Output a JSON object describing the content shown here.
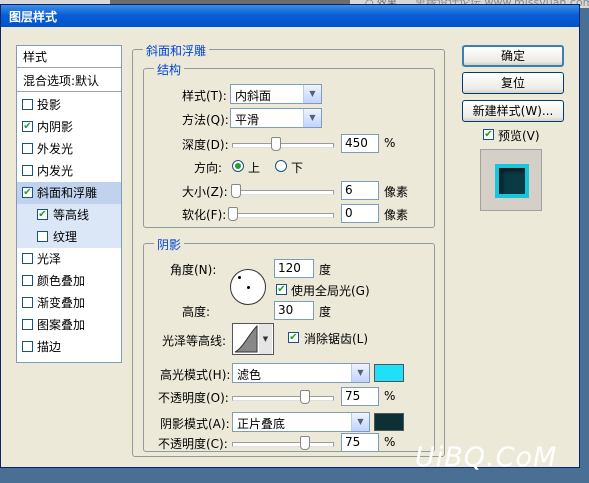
{
  "top_strip": {
    "left_text": "○ 效果",
    "watermark": "思缘设计论坛 www.missvuan.com"
  },
  "window": {
    "title": "图层样式"
  },
  "styles_panel": {
    "header": "样式",
    "blending": "混合选项:默认",
    "items": [
      {
        "label": "投影",
        "checked": false
      },
      {
        "label": "内阴影",
        "checked": true
      },
      {
        "label": "外发光",
        "checked": false
      },
      {
        "label": "内发光",
        "checked": false
      },
      {
        "label": "斜面和浮雕",
        "checked": true
      },
      {
        "label": "等高线",
        "checked": true
      },
      {
        "label": "纹理",
        "checked": false
      },
      {
        "label": "光泽",
        "checked": false
      },
      {
        "label": "颜色叠加",
        "checked": false
      },
      {
        "label": "渐变叠加",
        "checked": false
      },
      {
        "label": "图案叠加",
        "checked": false
      },
      {
        "label": "描边",
        "checked": false
      }
    ]
  },
  "bevel": {
    "group_title": "斜面和浮雕",
    "structure": {
      "title": "结构",
      "style_label": "样式(T):",
      "style_value": "内斜面",
      "technique_label": "方法(Q):",
      "technique_value": "平滑",
      "depth_label": "深度(D):",
      "depth_value": "450",
      "depth_unit": "%",
      "depth_slider": 0.45,
      "direction_label": "方向:",
      "direction_up": "上",
      "direction_down": "下",
      "direction_selected": "上",
      "size_label": "大小(Z):",
      "size_value": "6",
      "size_unit": "像素",
      "size_slider": 0.03,
      "soften_label": "软化(F):",
      "soften_value": "0",
      "soften_unit": "像素",
      "soften_slider": 0
    },
    "shading": {
      "title": "阴影",
      "angle_label": "角度(N):",
      "angle_value": "120",
      "angle_unit": "度",
      "global_light_label": "使用全局光(G)",
      "global_light": true,
      "altitude_label": "高度:",
      "altitude_value": "30",
      "altitude_unit": "度",
      "gloss_contour_label": "光泽等高线:",
      "antialias_label": "消除锯齿(L)",
      "antialias": true,
      "highlight_mode_label": "高光模式(H):",
      "highlight_mode": "滤色",
      "highlight_color": "#1fe0f8",
      "highlight_opacity_label": "不透明度(O):",
      "highlight_opacity": "75",
      "highlight_opacity_unit": "%",
      "highlight_slider": 0.75,
      "shadow_mode_label": "阴影模式(A):",
      "shadow_mode": "正片叠底",
      "shadow_color": "#0c3036",
      "shadow_opacity_label": "不透明度(C):",
      "shadow_opacity": "75",
      "shadow_opacity_unit": "%",
      "shadow_slider": 0.75
    }
  },
  "buttons": {
    "ok": "确定",
    "reset": "复位",
    "new_style": "新建样式(W)...",
    "preview": "预览(V)",
    "preview_checked": true
  },
  "watermark_bottom": "UiBQ.CoM"
}
